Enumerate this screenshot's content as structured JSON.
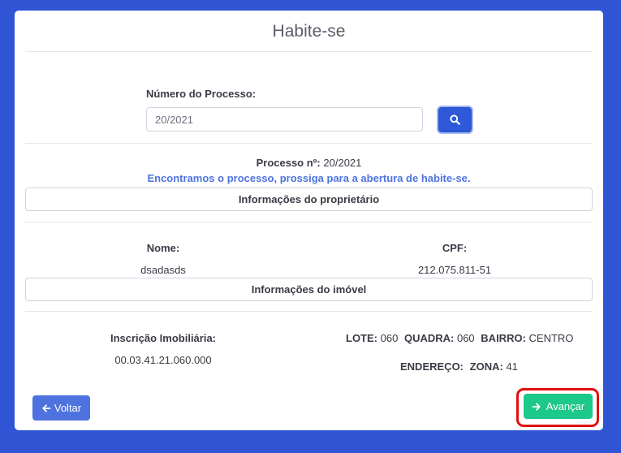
{
  "page": {
    "title": "Habite-se"
  },
  "search": {
    "label": "Número do Processo:",
    "value": "20/2021"
  },
  "result": {
    "processo_label": "Processo nº:",
    "processo_value": "20/2021",
    "message": "Encontramos o processo, prossiga para a abertura de habite-se."
  },
  "owner_section": {
    "header": "Informações do proprietário",
    "name_label": "Nome:",
    "name_value": "dsadasds",
    "cpf_label": "CPF:",
    "cpf_value": "212.075.811-51"
  },
  "property_section": {
    "header": "Informações do imóvel",
    "inscricao_label": "Inscrição Imobiliária:",
    "inscricao_value": "00.03.41.21.060.000",
    "lote_label": "LOTE:",
    "lote_value": "060",
    "quadra_label": "QUADRA:",
    "quadra_value": "060",
    "bairro_label": "BAIRRO:",
    "bairro_value": "CENTRO",
    "endereco_label": "ENDEREÇO:",
    "endereco_value": "",
    "zona_label": "ZONA:",
    "zona_value": "41"
  },
  "actions": {
    "back_label": "Voltar",
    "next_label": "Avançar"
  },
  "colors": {
    "background": "#2f55d4",
    "primary": "#4e73df",
    "success": "#1cc88a",
    "highlight": "#e01010"
  }
}
